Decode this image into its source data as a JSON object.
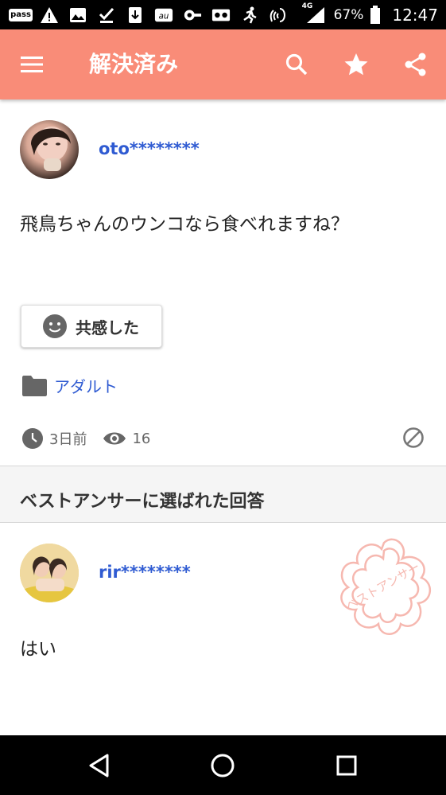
{
  "status_bar": {
    "pass_label": "pass",
    "network_label": "4G",
    "battery_percent": "67%",
    "time": "12:47"
  },
  "app_bar": {
    "title": "解決済み",
    "icons": [
      "menu-icon",
      "search-icon",
      "star-icon",
      "share-icon"
    ]
  },
  "question": {
    "username": "oto********",
    "text": "飛鳥ちゃんのウンコなら食べれますね？",
    "empathy_label": "共感した",
    "category": "アダルト",
    "posted": "3日前",
    "views": "16"
  },
  "best_answer": {
    "section_title": "ベストアンサーに選ばれた回答",
    "username": "rir********",
    "text": "はい",
    "stamp_text": "ベストアンサー"
  },
  "colors": {
    "app_bar": "#f98c78",
    "link_blue": "#2f5bd2",
    "stamp": "#f6b8b0"
  }
}
